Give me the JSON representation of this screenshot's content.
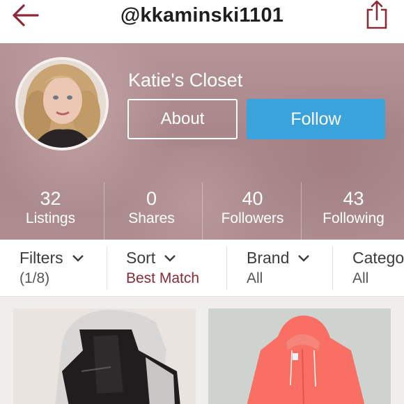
{
  "header": {
    "username": "@kkaminski1101",
    "back_icon": "back-arrow-icon",
    "share_icon": "share-icon",
    "accent_color": "#8a2a36"
  },
  "profile": {
    "closet_name": "Katie's Closet",
    "about_label": "About",
    "follow_label": "Follow",
    "follow_color": "#3aa3dc",
    "stats": [
      {
        "value": "32",
        "label": "Listings"
      },
      {
        "value": "0",
        "label": "Shares"
      },
      {
        "value": "40",
        "label": "Followers"
      },
      {
        "value": "43",
        "label": "Following"
      }
    ]
  },
  "filters": [
    {
      "title": "Filters",
      "value": "(1/8)",
      "icon": "chevron-down-icon"
    },
    {
      "title": "Sort",
      "value": "Best Match",
      "icon": "chevron-down-icon"
    },
    {
      "title": "Brand",
      "value": "All",
      "icon": "chevron-down-icon"
    },
    {
      "title": "Category",
      "value": "All",
      "icon": "chevron-down-icon"
    }
  ],
  "listings": [
    {
      "item": "black leather jacket with grey hood"
    },
    {
      "item": "coral pink hooded jacket"
    }
  ]
}
